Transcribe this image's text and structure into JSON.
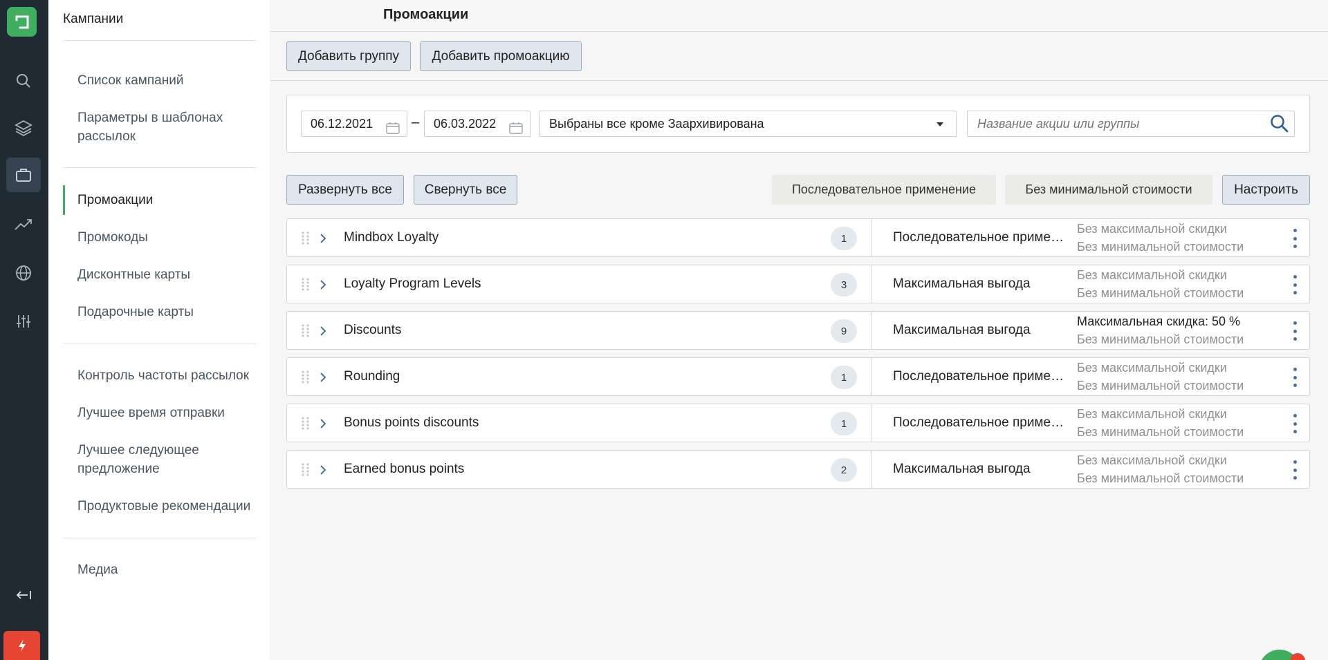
{
  "sidebar": {
    "title": "Кампании",
    "groups": [
      [
        "Список кампаний",
        "Параметры в шаблонах рассылок"
      ],
      [
        "Промоакции",
        "Промокоды",
        "Дисконтные карты",
        "Подарочные карты"
      ],
      [
        "Контроль частоты рассылок",
        "Лучшее время отправки",
        "Лучшее следующее предложение",
        "Продуктовые рекомендации"
      ],
      [
        "Медиа"
      ]
    ],
    "active_item": "Промоакции"
  },
  "header": {
    "title": "Промоакции"
  },
  "toolbar": {
    "add_group": "Добавить группу",
    "add_promo": "Добавить промоакцию"
  },
  "filters": {
    "date_from": "06.12.2021",
    "date_separator": "–",
    "date_to": "06.03.2022",
    "status": "Выбраны все кроме Заархивирована",
    "search_placeholder": "Название акции или группы"
  },
  "actions": {
    "expand_all": "Развернуть все",
    "collapse_all": "Свернуть все",
    "chip_sequential": "Последовательное применение",
    "chip_no_min": "Без минимальной стоимости",
    "configure": "Настроить"
  },
  "groups": [
    {
      "name": "Mindbox Loyalty",
      "count": "1",
      "mode": "Последовательное применение",
      "limit1": "Без максимальной скидки",
      "limit2": "Без минимальной стоимости"
    },
    {
      "name": "Loyalty Program Levels",
      "count": "3",
      "mode": "Максимальная выгода",
      "limit1": "Без максимальной скидки",
      "limit2": "Без минимальной стоимости"
    },
    {
      "name": "Discounts",
      "count": "9",
      "mode": "Максимальная выгода",
      "limit1": "Максимальная скидка: 50 %",
      "limit2": "Без минимальной стоимости"
    },
    {
      "name": "Rounding",
      "count": "1",
      "mode": "Последовательное применение",
      "limit1": "Без максимальной скидки",
      "limit2": "Без минимальной стоимости"
    },
    {
      "name": "Bonus points discounts",
      "count": "1",
      "mode": "Последовательное применение",
      "limit1": "Без максимальной скидки",
      "limit2": "Без минимальной стоимости"
    },
    {
      "name": "Earned bonus points",
      "count": "2",
      "mode": "Максимальная выгода",
      "limit1": "Без максимальной скидки",
      "limit2": "Без минимальной стоимости"
    }
  ],
  "colors": {
    "accent": "#3fae5e",
    "rail": "#1f2a33",
    "danger": "#e64534",
    "kebab": "#4a6fa0"
  }
}
